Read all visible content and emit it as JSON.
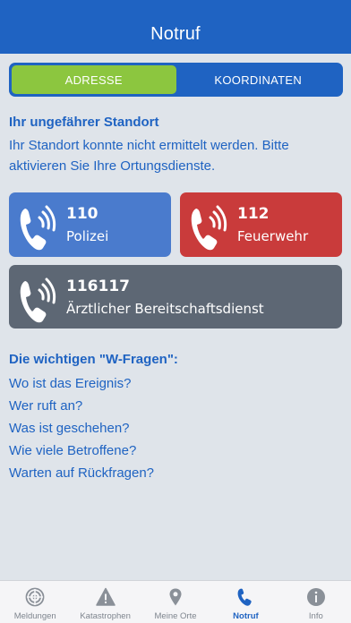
{
  "header": {
    "title": "Notruf"
  },
  "segment": {
    "options": [
      "ADRESSE",
      "KOORDINATEN"
    ],
    "selected": "ADRESSE"
  },
  "location": {
    "title": "Ihr ungefährer Standort",
    "message": "Ihr Standort konnte nicht ermittelt werden. Bitte aktivieren Sie Ihre Ortungsdienste."
  },
  "emergency": {
    "police": {
      "number": "110",
      "label": "Polizei",
      "color": "#4a7bcd"
    },
    "fire": {
      "number": "112",
      "label": "Feuerwehr",
      "color": "#c93b3b"
    },
    "doctor": {
      "number": "116117",
      "label": "Ärztlicher Bereitschaftsdienst",
      "color": "#5d6774"
    }
  },
  "w_questions": {
    "title": "Die wichtigen \"W-Fragen\":",
    "items": [
      "Wo ist das Ereignis?",
      "Wer ruft an?",
      "Was ist geschehen?",
      "Wie viele Betroffene?",
      "Warten auf Rückfragen?"
    ]
  },
  "tabbar": {
    "items": [
      {
        "label": "Meldungen",
        "icon": "radar-icon"
      },
      {
        "label": "Katastrophen",
        "icon": "warning-icon"
      },
      {
        "label": "Meine Orte",
        "icon": "pin-icon"
      },
      {
        "label": "Notruf",
        "icon": "phone-icon"
      },
      {
        "label": "Info",
        "icon": "info-icon"
      }
    ],
    "active": "Notruf"
  },
  "colors": {
    "primary": "#1f63c2",
    "accent_green": "#8cc63f",
    "background": "#dfe4ea"
  }
}
